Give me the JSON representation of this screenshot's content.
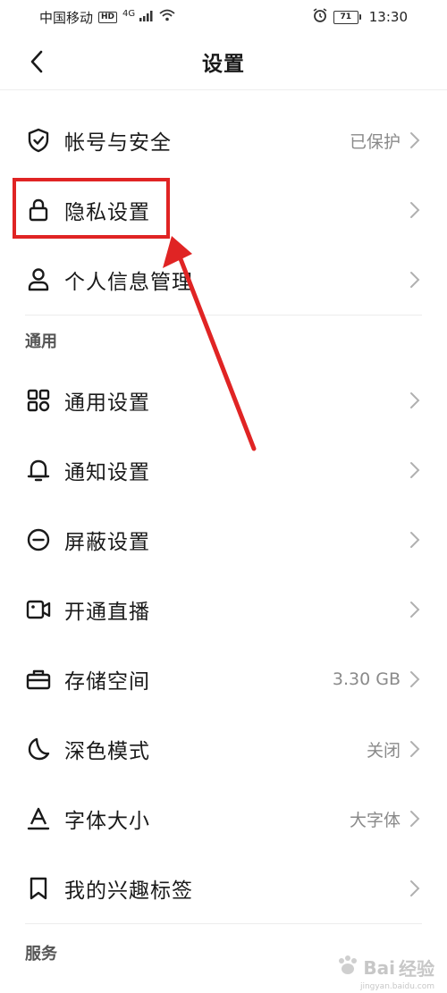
{
  "status_bar": {
    "carrier": "中国移动",
    "hd": "HD",
    "signal": "4G",
    "battery": "71",
    "time": "13:30"
  },
  "header": {
    "title": "设置"
  },
  "account_items": [
    {
      "label": "帐号与安全",
      "value": "已保护",
      "icon": "shield-check-icon"
    },
    {
      "label": "隐私设置",
      "value": "",
      "icon": "lock-icon"
    },
    {
      "label": "个人信息管理",
      "value": "",
      "icon": "person-icon"
    }
  ],
  "general": {
    "section_title": "通用",
    "items": [
      {
        "label": "通用设置",
        "value": "",
        "icon": "grid-icon"
      },
      {
        "label": "通知设置",
        "value": "",
        "icon": "bell-icon"
      },
      {
        "label": "屏蔽设置",
        "value": "",
        "icon": "block-icon"
      },
      {
        "label": "开通直播",
        "value": "",
        "icon": "video-camera-icon"
      },
      {
        "label": "存储空间",
        "value": "3.30 GB",
        "icon": "storage-icon"
      },
      {
        "label": "深色模式",
        "value": "关闭",
        "icon": "moon-icon"
      },
      {
        "label": "字体大小",
        "value": "大字体",
        "icon": "font-size-icon"
      },
      {
        "label": "我的兴趣标签",
        "value": "",
        "icon": "bookmark-icon"
      }
    ]
  },
  "services": {
    "section_title": "服务"
  },
  "annotation": {
    "highlight_color": "#e02424"
  },
  "watermark": {
    "brand": "Bai",
    "brand_suffix": "经验",
    "sub": "jingyan.baidu.com"
  }
}
